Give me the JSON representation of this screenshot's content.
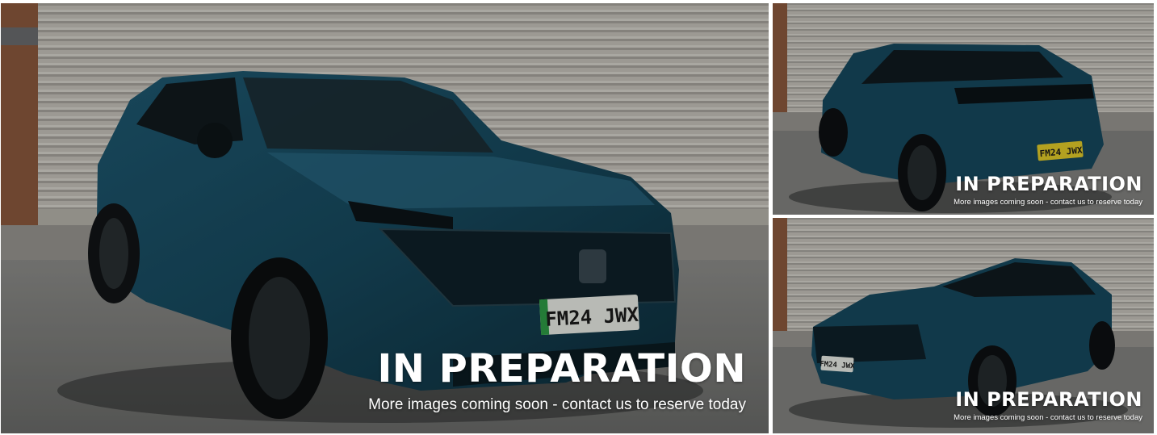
{
  "gallery": {
    "main": {
      "plate": "FM24 JWX",
      "overlay_title": "IN PREPARATION",
      "overlay_subtitle": "More images coming soon - contact us to reserve today"
    },
    "thumbnails": [
      {
        "plate": "FM24 JWX",
        "overlay_title": "IN PREPARATION",
        "overlay_subtitle": "More images coming soon - contact us to reserve today"
      },
      {
        "plate": "FM24 JWX",
        "overlay_title": "IN PREPARATION",
        "overlay_subtitle": "More images coming soon - contact us to reserve today"
      }
    ]
  },
  "colors": {
    "car_body": "#17475a",
    "plate_front": "#ecefe8",
    "plate_rear": "#e6cf2a",
    "overlay_text": "#ffffff"
  }
}
